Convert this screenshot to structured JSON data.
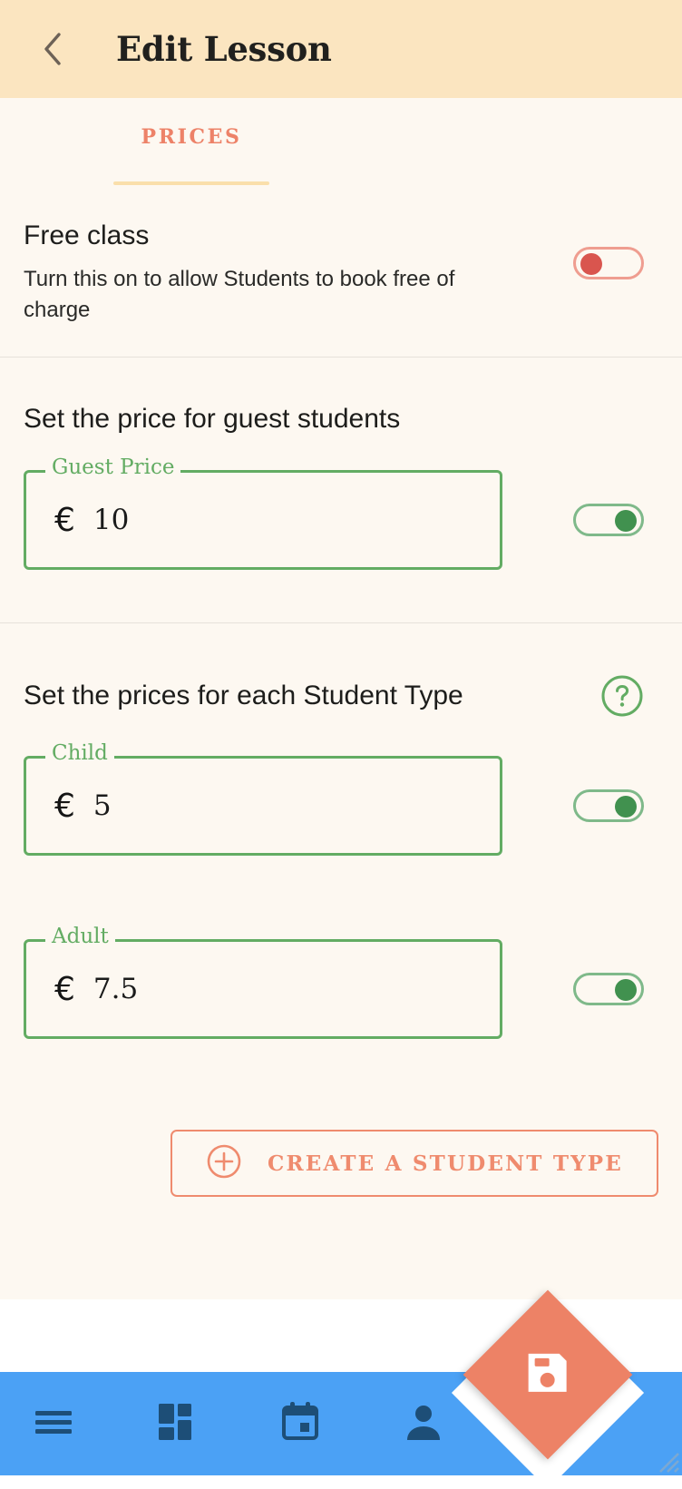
{
  "header": {
    "title": "Edit Lesson",
    "back_icon": "chevron-left-icon",
    "background": "#fbe5c0"
  },
  "tabs": [
    {
      "label": "PRICES",
      "active": true,
      "color": "#ed8268",
      "underline_color": "#fadfab"
    }
  ],
  "sections": {
    "free_class": {
      "title": "Free class",
      "description": "Turn this on to allow Students to book free of charge",
      "toggle": {
        "state": "off",
        "knob_color": "#d9554e",
        "track_color": "#ef9d90"
      }
    },
    "guest": {
      "title": "Set the price for guest students",
      "field": {
        "label": "Guest Price",
        "currency": "€",
        "value": "10",
        "border_color": "#63ac63"
      },
      "toggle": {
        "state": "on",
        "knob_color": "#41914f",
        "track_color": "#7fb98a"
      }
    },
    "student_types": {
      "title": "Set the prices for each Student Type",
      "help_icon": "help-circle-icon",
      "help_icon_color": "#63ac63",
      "items": [
        {
          "label": "Child",
          "currency": "€",
          "value": "5",
          "toggle": {
            "state": "on"
          }
        },
        {
          "label": "Adult",
          "currency": "€",
          "value": "7.5",
          "toggle": {
            "state": "on"
          }
        }
      ],
      "create_button": {
        "label": "CREATE A STUDENT TYPE",
        "icon": "plus-circle-icon",
        "color": "#ef8b6e"
      }
    }
  },
  "bottom_nav": {
    "background": "#4ba1f5",
    "icon_color": "#1d4e77",
    "items": [
      {
        "name": "menu-icon"
      },
      {
        "name": "dashboard-icon"
      },
      {
        "name": "calendar-icon"
      },
      {
        "name": "person-icon"
      }
    ],
    "fab": {
      "icon": "save-icon",
      "color": "#ed8266"
    }
  }
}
